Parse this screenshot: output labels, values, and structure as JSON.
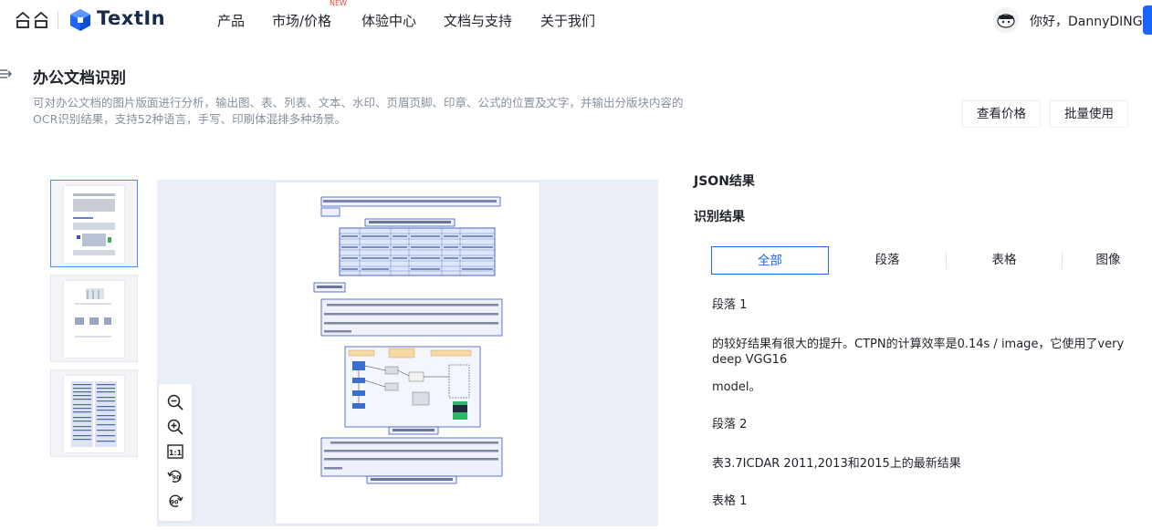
{
  "nav": {
    "brand": "TextIn",
    "items": [
      "产品",
      "市场/价格",
      "体验中心",
      "文档与支持",
      "关于我们"
    ],
    "new_badge": "NEW",
    "greeting": "你好，DannyDING"
  },
  "page": {
    "title": "办公文档识别",
    "description": "可对办公文档的图片版面进行分析，输出图、表、列表、文本、水印、页眉页脚、印章、公式的位置及文字，并输出分版块内容的OCR识别结果，支持52种语言，手写、印刷体混排多种场景。",
    "btn_price": "查看价格",
    "btn_batch": "批量使用"
  },
  "results": {
    "json_title": "JSON结果",
    "section_title": "识别结果",
    "tabs": [
      "全部",
      "段落",
      "表格",
      "图像"
    ],
    "active_tab": "全部",
    "lines": [
      "段落 1",
      "的较好结果有很大的提升。CTPN的计算效率是0.14s / image，它使用了very deep VGG16",
      "model。",
      "段落 2",
      "表3.7ICDAR 2011,2013和2015上的最新结果",
      "表格 1"
    ]
  },
  "zoom": {
    "actual_size_label": "1:1",
    "rotate_left_label": "90",
    "rotate_right_label": "90"
  },
  "colors": {
    "accent": "#1a66ff",
    "muted_text": "#86909c",
    "doc_highlight": "#3b55c9"
  }
}
